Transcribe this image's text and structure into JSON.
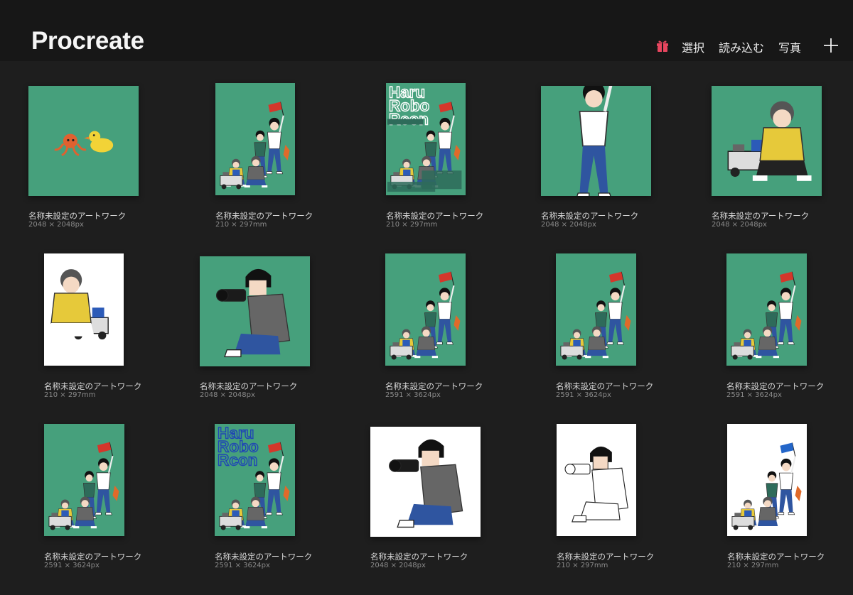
{
  "header": {
    "title": "Procreate",
    "select_label": "選択",
    "import_label": "読み込む",
    "photo_label": "写真",
    "gift_icon": "gift-icon",
    "add_icon": "plus-icon",
    "gift_color": "#e8465f"
  },
  "gallery": {
    "artworks": [
      {
        "name": "名称未設定のアートワーク",
        "size": "2048 × 2048px",
        "thumb": "octopus-duck-green"
      },
      {
        "name": "名称未設定のアートワーク",
        "size": "210 × 297mm",
        "thumb": "group-scene-green"
      },
      {
        "name": "名称未設定のアートワーク",
        "size": "210 × 297mm",
        "thumb": "haru-robo-con-poster"
      },
      {
        "name": "名称未設定のアートワーク",
        "size": "2048 × 2048px",
        "thumb": "flag-person-green"
      },
      {
        "name": "名称未設定のアートワーク",
        "size": "2048 × 2048px",
        "thumb": "robot-builder-green"
      },
      {
        "name": "名称未設定のアートワーク",
        "size": "210 × 297mm",
        "thumb": "robot-builder-white"
      },
      {
        "name": "名称未設定のアートワーク",
        "size": "2048 × 2048px",
        "thumb": "photographer-green"
      },
      {
        "name": "名称未設定のアートワーク",
        "size": "2591 × 3624px",
        "thumb": "group-scene-green"
      },
      {
        "name": "名称未設定のアートワーク",
        "size": "2591 × 3624px",
        "thumb": "group-scene-green"
      },
      {
        "name": "名称未設定のアートワーク",
        "size": "2591 × 3624px",
        "thumb": "group-scene-green"
      },
      {
        "name": "名称未設定のアートワーク",
        "size": "2591 × 3624px",
        "thumb": "group-scene-green"
      },
      {
        "name": "名称未設定のアートワーク",
        "size": "2591 × 3624px",
        "thumb": "haru-robo-con-green"
      },
      {
        "name": "名称未設定のアートワーク",
        "size": "2048 × 2048px",
        "thumb": "photographer-white"
      },
      {
        "name": "名称未設定のアートワーク",
        "size": "210 × 297mm",
        "thumb": "lineart-photographer-white"
      },
      {
        "name": "名称未設定のアートワーク",
        "size": "210 × 297mm",
        "thumb": "group-scene-white-blue-flag"
      }
    ],
    "poster_text": {
      "line1": "Haru",
      "line2": "Robo",
      "line3": "Rcon"
    }
  },
  "colors": {
    "canvas_green": "#46a07c",
    "background": "#1e1e1e",
    "header_bg": "#171717",
    "flag_red": "#d4372b",
    "flag_blue": "#2466c9",
    "shirt_yellow": "#e6c93a",
    "jeans_blue": "#2f55a0"
  }
}
